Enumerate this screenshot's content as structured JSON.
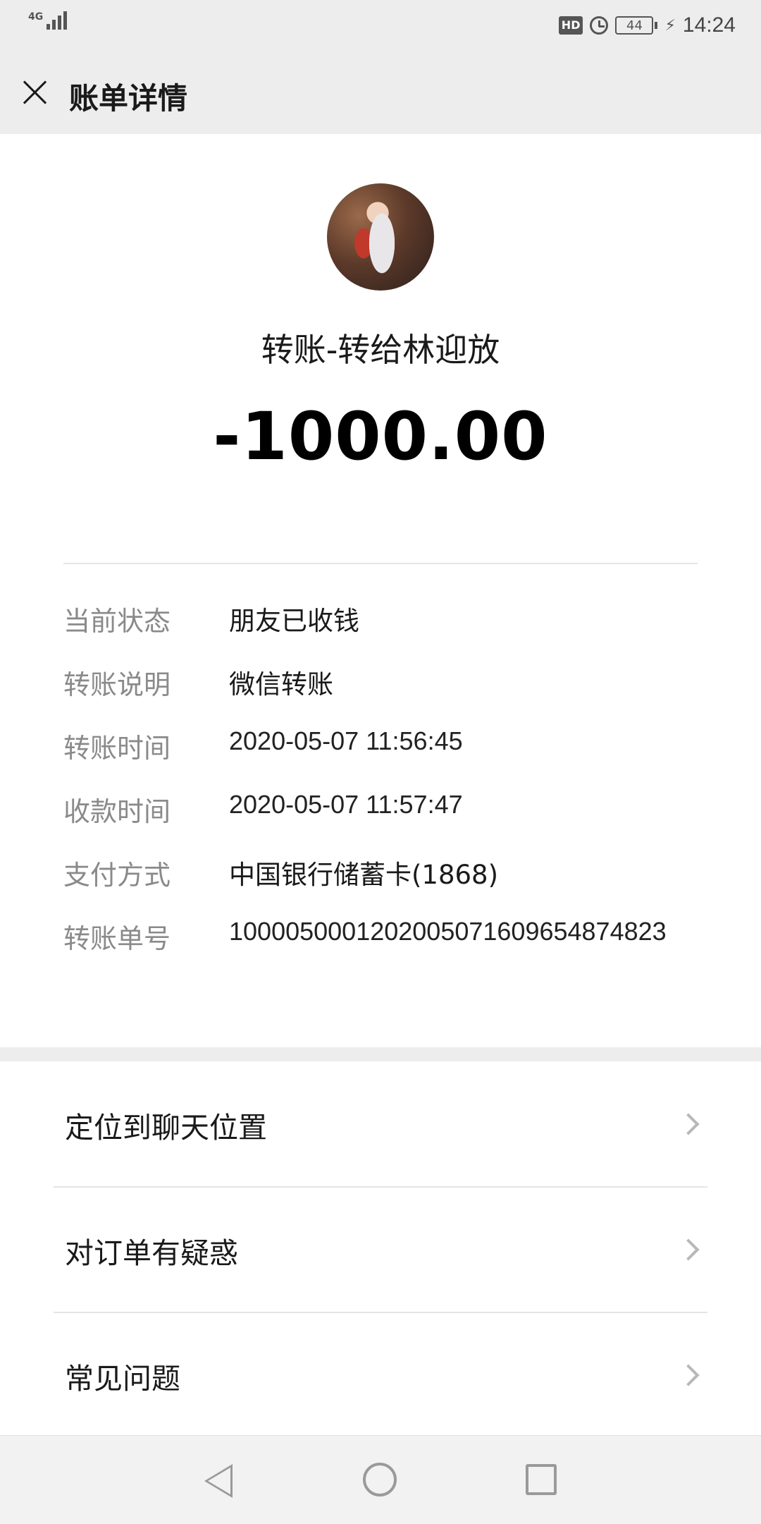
{
  "status_bar": {
    "network": "4G",
    "hd_badge": "HD",
    "battery_level": "44",
    "time": "14:24"
  },
  "header": {
    "title": "账单详情",
    "close_icon": "close-icon"
  },
  "transaction": {
    "title": "转账-转给林迎放",
    "amount": "-1000.00"
  },
  "details": [
    {
      "label": "当前状态",
      "value": "朋友已收钱"
    },
    {
      "label": "转账说明",
      "value": "微信转账"
    },
    {
      "label": "转账时间",
      "value": "2020-05-07  11:56:45"
    },
    {
      "label": "收款时间",
      "value": "2020-05-07  11:57:47"
    },
    {
      "label": "支付方式",
      "value": "中国银行储蓄卡(1868)"
    },
    {
      "label": "转账单号",
      "value": "1000050001202005071609654874823"
    }
  ],
  "links": [
    {
      "label": "定位到聊天位置"
    },
    {
      "label": "对订单有疑惑"
    },
    {
      "label": "常见问题"
    }
  ],
  "colors": {
    "background": "#ededed",
    "card": "#ffffff",
    "label_gray": "#8a8a8a",
    "text": "#1a1a1a"
  }
}
